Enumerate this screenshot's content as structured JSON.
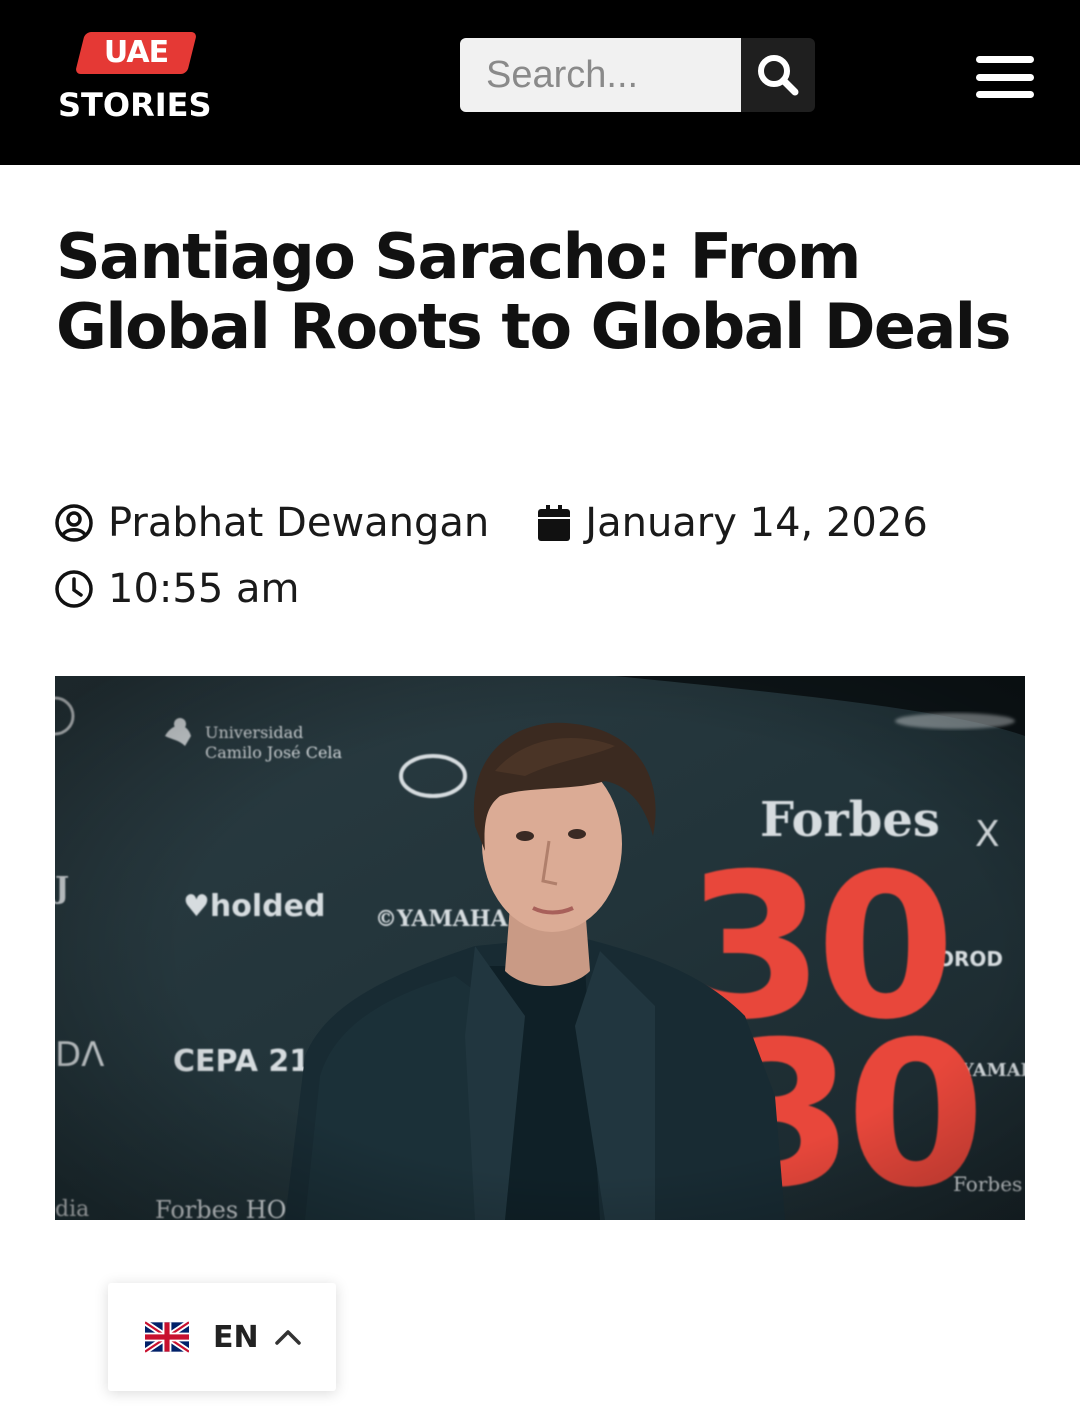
{
  "header": {
    "logo_badge": "UAE",
    "logo_text": "STORIES",
    "search_placeholder": "Search...",
    "icons": {
      "search": "search-icon",
      "menu": "hamburger-menu-icon"
    },
    "colors": {
      "bar": "#000000",
      "brand_red": "#e53935"
    }
  },
  "article": {
    "title": "Santiago Saracho: From Global Roots to Global Deals",
    "author": "Prabhat Dewangan",
    "date": "January 14, 2026",
    "time": "10:55 am",
    "icons": {
      "author": "user-circle-icon",
      "date": "calendar-icon",
      "time": "clock-icon"
    }
  },
  "hero_image": {
    "backdrop_logos": [
      "Universidad Camilo José Cela",
      "holded",
      "YAMAHA",
      "CEPA 21",
      "Forbes",
      "Forbes HO"
    ],
    "backdrop_big_text": [
      "30",
      "30"
    ],
    "colors": {
      "backdrop": "#1f2e33",
      "accent": "#e8463a"
    }
  },
  "language": {
    "code": "EN",
    "flag": "uk-flag-icon",
    "chevron": "chevron-up-icon"
  }
}
